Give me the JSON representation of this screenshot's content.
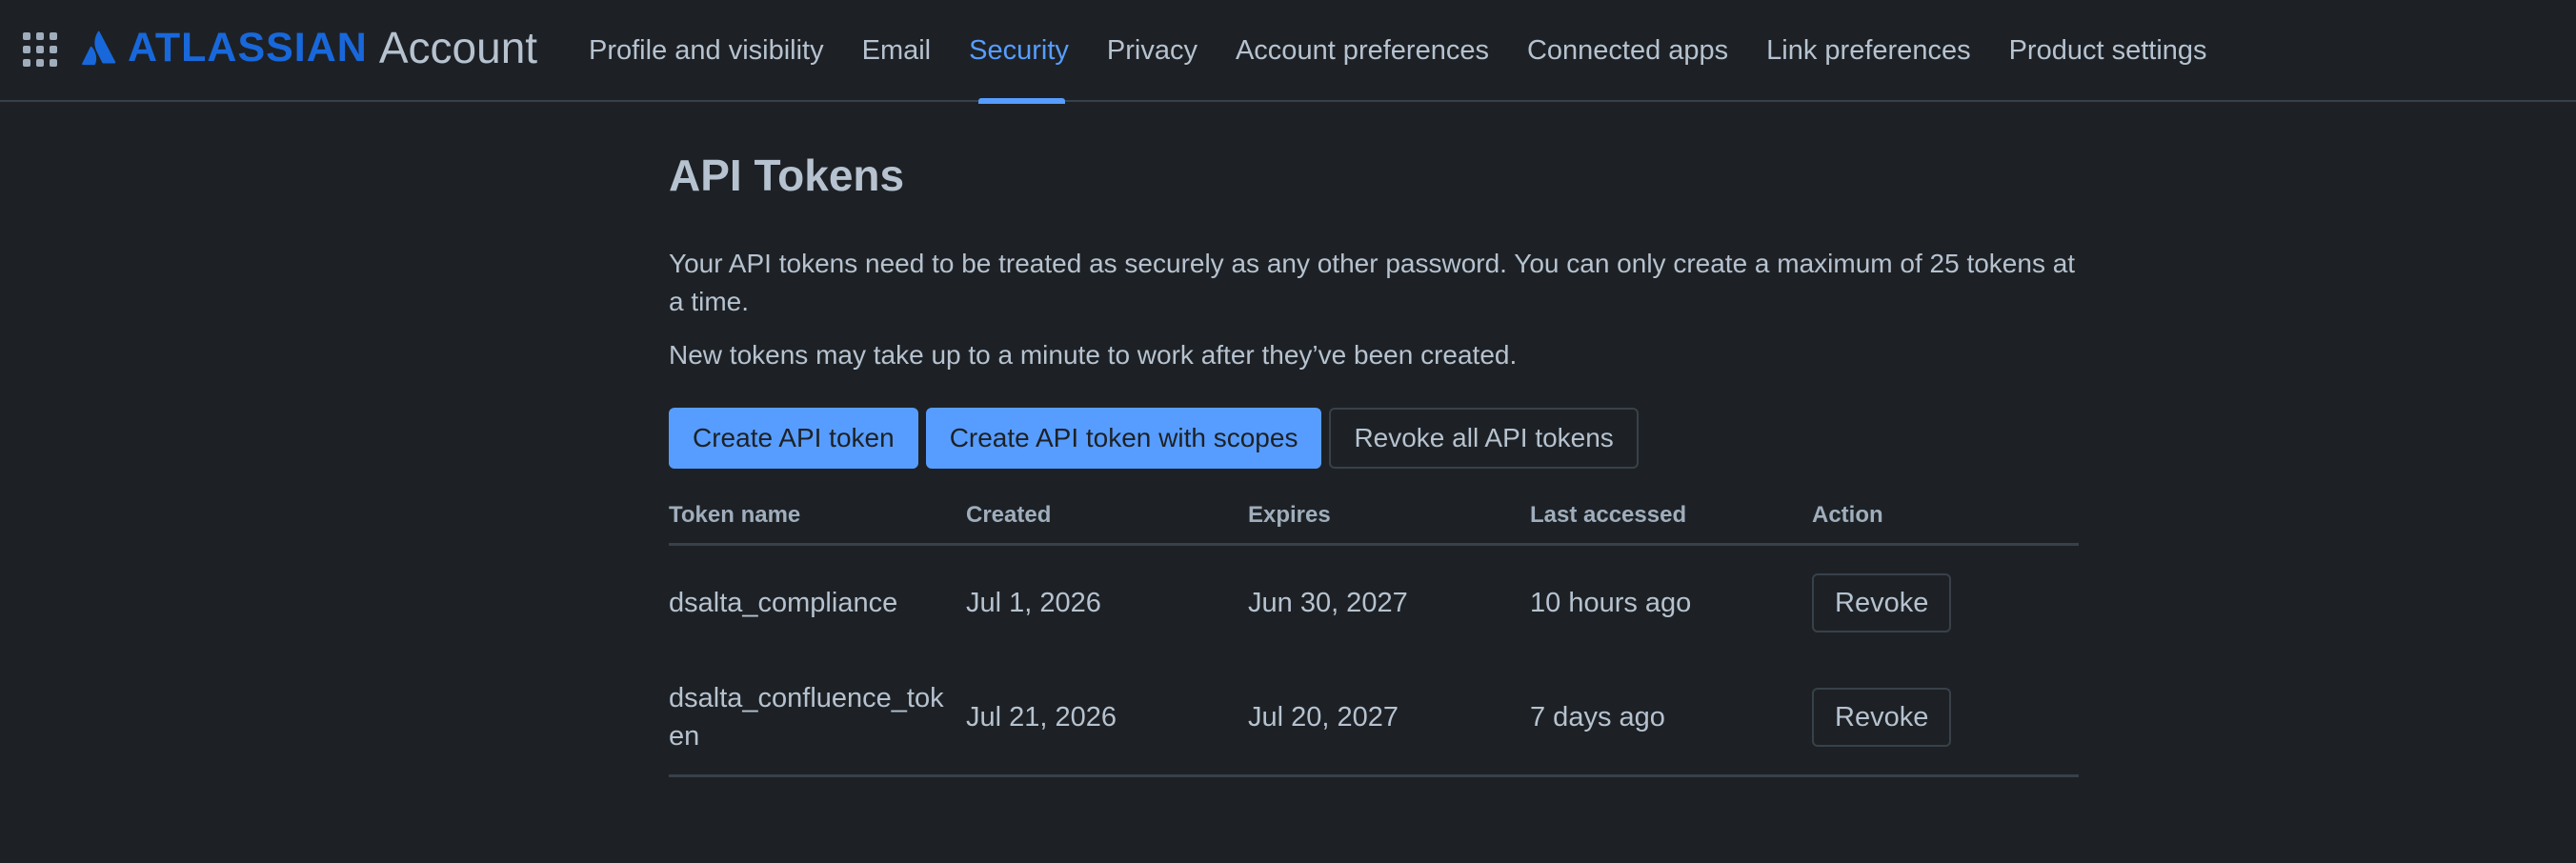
{
  "header": {
    "brand": "ATLASSIAN",
    "product": "Account",
    "app_switcher_icon": "grid-icon",
    "logo_icon": "atlassian-logo-icon",
    "brand_color": "#1868db",
    "tabs": [
      {
        "label": "Profile and visibility"
      },
      {
        "label": "Email"
      },
      {
        "label": "Security",
        "active": true
      },
      {
        "label": "Privacy"
      },
      {
        "label": "Account preferences"
      },
      {
        "label": "Connected apps"
      },
      {
        "label": "Link preferences"
      },
      {
        "label": "Product settings"
      }
    ]
  },
  "main": {
    "title": "API Tokens",
    "description": "Your API tokens need to be treated as securely as any other password. You can only create a maximum of 25 tokens at a time.",
    "description2": "New tokens may take up to a minute to work after they’ve been created.",
    "buttons": {
      "create": "Create API token",
      "create_scopes": "Create API token with scopes",
      "revoke_all": "Revoke all API tokens"
    },
    "table": {
      "headers": [
        "Token name",
        "Created",
        "Expires",
        "Last accessed",
        "Action"
      ],
      "rows": [
        {
          "name": "dsalta_compliance",
          "created": "Jul 1, 2026",
          "expires": "Jun 30, 2027",
          "last_accessed": "10 hours ago",
          "action": "Revoke"
        },
        {
          "name": "dsalta_confluence_token",
          "created": "Jul 21, 2026",
          "expires": "Jul 20, 2027",
          "last_accessed": "7 days ago",
          "action": "Revoke"
        }
      ]
    }
  },
  "colors": {
    "background": "#1d2125",
    "accent": "#579dff",
    "text": "#b6c2cf",
    "border": "#38414a"
  }
}
